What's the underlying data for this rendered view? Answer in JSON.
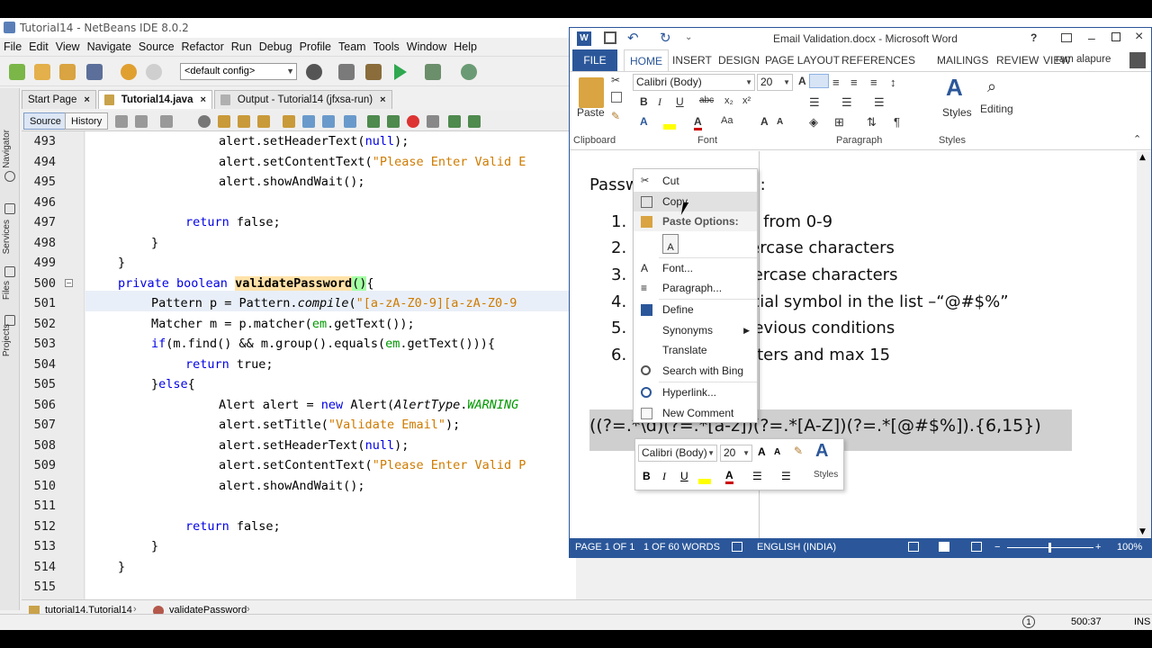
{
  "netbeans": {
    "title": "Tutorial14 - NetBeans IDE 8.0.2",
    "menu": [
      "File",
      "Edit",
      "View",
      "Navigate",
      "Source",
      "Refactor",
      "Run",
      "Debug",
      "Profile",
      "Team",
      "Tools",
      "Window",
      "Help"
    ],
    "config": "<default config>",
    "tabs": [
      {
        "label": "Start Page"
      },
      {
        "label": "Tutorial14.java"
      },
      {
        "label": "Output - Tutorial14 (jfxsa-run)"
      }
    ],
    "side_tabs": [
      "Navigator",
      "Services",
      "Files",
      "Projects"
    ],
    "source_label": "Source",
    "history_label": "History",
    "line_numbers": [
      "493",
      "494",
      "495",
      "496",
      "497",
      "498",
      "499",
      "500",
      "501",
      "502",
      "503",
      "504",
      "505",
      "506",
      "507",
      "508",
      "509",
      "510",
      "511",
      "512",
      "513",
      "514",
      "515"
    ],
    "code": {
      "l493a": "alert.setHeaderText(",
      "l493b": "null",
      "l493c": ");",
      "l494a": "alert.setContentText(",
      "l494s": "\"Please Enter Valid E",
      "l495": "alert.showAndWait();",
      "l497k": "return",
      "l497b": " false;",
      "l498": "}",
      "l499": "}",
      "l500k": "private boolean",
      "l500m": "validatePassword",
      "l500p": "()",
      "l500e": "{",
      "l501a": "Pattern p = Pattern.",
      "l501i": "compile",
      "l501b": "(",
      "l501s": "\"[a-zA-Z0-9][a-zA-Z0-9",
      "l502a": "Matcher m = p.matcher(",
      "l502f": "em",
      ".l502b": "",
      "l502c": ".getText());",
      "l503k": "if",
      "l503a": "(m.find() && m.group().equals(",
      "l503f": "em",
      "l503b": ".getText())){",
      "l504k": "return",
      "l504b": " true;",
      "l505a": "}",
      "l505k": "else",
      "l505b": "{",
      "l506a": "Alert alert = ",
      "l506k": "new",
      "l506b": " Alert(",
      "l506i": "AlertType",
      "l506d": ".",
      "l506f": "WARNING",
      "l507a": "alert.setTitle(",
      "l507s": "\"Validate Email\"",
      "l507b": ");",
      "l508a": "alert.setHeaderText(",
      "l508b": "null",
      "l508c": ");",
      "l509a": "alert.setContentText(",
      "l509s": "\"Please Enter Valid P",
      "l510": "alert.showAndWait();",
      "l512k": "return",
      "l512b": " false;",
      "l513": "}",
      "l514": "}"
    },
    "breadcrumb": [
      "tutorial14.Tutorial14",
      "validatePassword"
    ],
    "status": {
      "position": "500:37",
      "mode": "INS"
    }
  },
  "word": {
    "title": "Email Validation.docx - Microsoft Word",
    "help": "?",
    "user": "ram alapure",
    "tabs": [
      "FILE",
      "HOME",
      "INSERT",
      "DESIGN",
      "PAGE LAYOUT",
      "REFERENCES",
      "MAILINGS",
      "REVIEW",
      "VIEW"
    ],
    "ribbon": {
      "paste": "Paste",
      "font_name": "Calibri (Body)",
      "font_size": "20",
      "styles": "Styles",
      "editing": "Editing",
      "groups": [
        "Clipboard",
        "Font",
        "Paragraph",
        "Styles"
      ],
      "bold": "B",
      "italic": "I",
      "underline": "U",
      "strike": "abc",
      "sub": "x₂",
      "sup": "x²",
      "pilcrow": "¶",
      "grow": "A",
      "shrink": "A",
      "case": "Aa",
      "fcolor": "A"
    },
    "doc": {
      "heading_start": "Passw",
      "heading_end": ":",
      "items": [
        {
          "num": "1.",
          "frag": "I",
          "rest": "one digit from 0-9"
        },
        {
          "num": "2.",
          "frag": "I",
          "rest": "one lowercase characters"
        },
        {
          "num": "3.",
          "frag": "I",
          "rest": "one uppercase characters"
        },
        {
          "num": "4.",
          "frag": "I",
          "rest": "one special symbol in the list –“@#$%”"
        },
        {
          "num": "5.",
          "frag": "I",
          "rest": "; with previous conditions"
        },
        {
          "num": "6.",
          "frag": "I",
          "rest": "6 characters and max 15"
        }
      ],
      "regex_start": "((?=.*",
      "regex_mid": "\\d)(?=.*",
      "regex_end": "[a-z])(?=.*[A-Z])(?=.*[@#$%]).{6,15})"
    },
    "status": {
      "page": "PAGE 1 OF 1",
      "words": "1 OF 60 WORDS",
      "lang": "ENGLISH (INDIA)",
      "zoom": "100%"
    },
    "context_menu": {
      "items": [
        "Cut",
        "Copy",
        "Paste Options:",
        "Font...",
        "Paragraph...",
        "Define",
        "Synonyms",
        "Translate",
        "Search with Bing",
        "Hyperlink...",
        "New Comment"
      ]
    },
    "mini_toolbar": {
      "font": "Calibri (Body)",
      "size": "20",
      "styles": "Styles",
      "b": "B",
      "i": "I",
      "u": "U",
      "grow": "A",
      "shrink": "A",
      "color": "A"
    }
  }
}
